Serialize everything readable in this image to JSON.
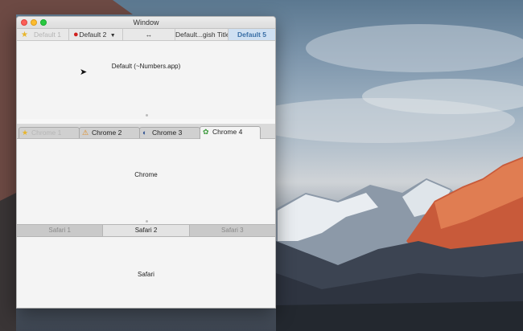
{
  "window": {
    "title": "Window"
  },
  "default_tabs": {
    "tabs": [
      {
        "label": "Default 1",
        "icon": "star-icon",
        "state": "disabled"
      },
      {
        "label": "Default 2",
        "icon": "red-circle-icon",
        "state": "normal",
        "has_menu": true
      },
      {
        "label": "↔",
        "icon": "",
        "state": "normal"
      },
      {
        "label": "Default...gish Title",
        "icon": "",
        "state": "normal"
      },
      {
        "label": "Default 5",
        "icon": "",
        "state": "selected"
      }
    ],
    "content_label": "Default (~Numbers.app)"
  },
  "chrome_tabs": {
    "tabs": [
      {
        "label": "Chrome 1",
        "icon": "star-icon",
        "state": "disabled"
      },
      {
        "label": "Chrome 2",
        "icon": "warning-icon",
        "state": "normal"
      },
      {
        "label": "Chrome 3",
        "icon": "globe-icon",
        "state": "normal"
      },
      {
        "label": "Chrome 4",
        "icon": "gear-icon",
        "state": "selected"
      }
    ],
    "content_label": "Chrome"
  },
  "safari_tabs": {
    "tabs": [
      {
        "label": "Safari 1",
        "state": "normal"
      },
      {
        "label": "Safari 2",
        "state": "selected"
      },
      {
        "label": "Safari 3",
        "state": "normal"
      }
    ],
    "content_label": "Safari"
  }
}
